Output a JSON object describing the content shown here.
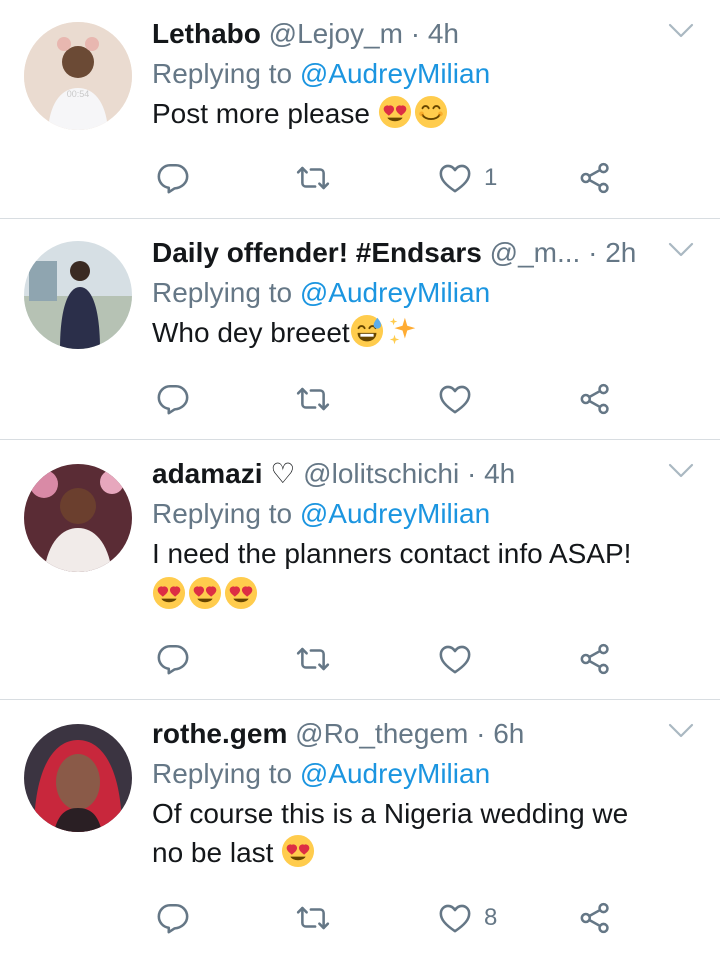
{
  "colors": {
    "mention": "#1b95e0",
    "secondary": "#657786",
    "divider": "#d8dde1"
  },
  "tweets": [
    {
      "name": "Lethabo",
      "handle": "@Lejoy_m",
      "sep": "·",
      "time": "4h",
      "reply_prefix": "Replying to",
      "reply_to": "@AudreyMilian",
      "text": "Post more please",
      "likes": "1",
      "avatar_text": "00:54"
    },
    {
      "name": "Daily offender! #Endsars",
      "handle": "@_m...",
      "sep": "·",
      "time": "2h",
      "reply_prefix": "Replying to",
      "reply_to": "@AudreyMilian",
      "text": "Who dey breeet",
      "likes": ""
    },
    {
      "name": "adamazi",
      "name_icon": "♡",
      "handle": "@lolitschichi",
      "sep": "·",
      "time": "4h",
      "reply_prefix": "Replying to",
      "reply_to": "@AudreyMilian",
      "text": "I need the planners contact info ASAP!",
      "likes": ""
    },
    {
      "name": "rothe.gem",
      "handle": "@Ro_thegem",
      "sep": "·",
      "time": "6h",
      "reply_prefix": "Replying to",
      "reply_to": "@AudreyMilian",
      "text_line1": "Of course this is a Nigeria wedding we",
      "text_line2": "no be last",
      "likes": "8"
    }
  ]
}
